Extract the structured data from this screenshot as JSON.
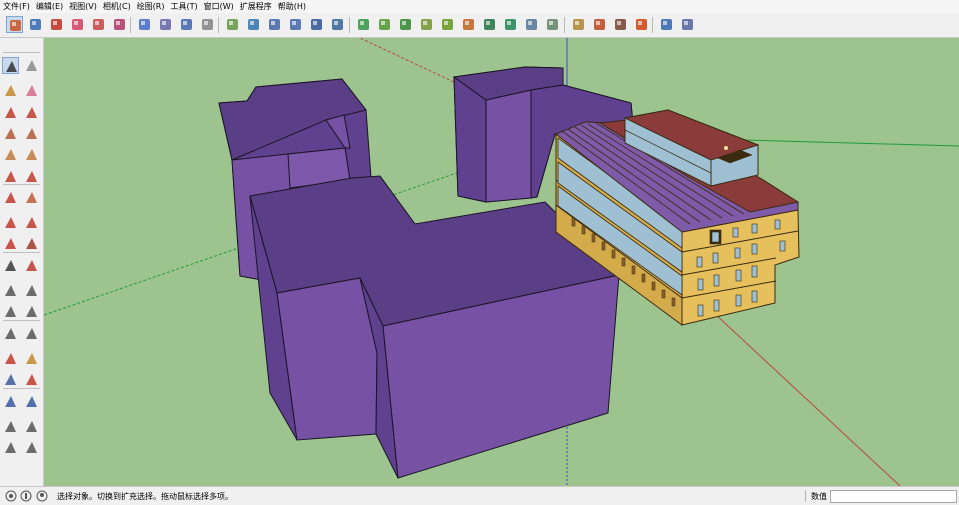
{
  "menu": [
    "文件(F)",
    "编辑(E)",
    "视图(V)",
    "相机(C)",
    "绘图(R)",
    "工具(T)",
    "窗口(W)",
    "扩展程序",
    "帮助(H)"
  ],
  "toolbar_icons": [
    "get-models-icon",
    "components-icon",
    "materials-icon",
    "styles-icon",
    "layers-icon",
    "scenes-icon",
    "iso-view-icon",
    "top-view-icon",
    "front-view-icon",
    "section-plane-icon",
    "new-surface-icon",
    "upload-icon",
    "save-geometry-icon",
    "save-component-icon",
    "idf-export-icon",
    "plugin-run-icon",
    "add-zone-icon",
    "add-space-icon",
    "add-shading-icon",
    "add-light-icon",
    "add-equipment-icon",
    "zone-loads-icon",
    "thermostat-icon",
    "hvac-icon",
    "render-mode-icon",
    "view-grid-icon",
    "search-icon",
    "filter-icon",
    "info-icon",
    "warning-icon",
    "box-icon",
    "help-icon"
  ],
  "left_tools": [
    "select-tool-icon",
    "make-component-icon",
    "paint-bucket-icon",
    "eraser-icon",
    "line-tool-icon",
    "freehand-tool-icon",
    "rectangle-tool-icon",
    "rotated-rectangle-icon",
    "circle-tool-icon",
    "polygon-tool-icon",
    "arc-tool-icon",
    "two-point-arc-icon",
    "three-point-arc-icon",
    "pie-tool-icon",
    "move-tool-icon",
    "push-pull-icon",
    "rotate-tool-icon",
    "follow-me-icon",
    "scale-tool-icon",
    "offset-tool-icon",
    "tape-measure-icon",
    "dimension-tool-icon",
    "protractor-icon",
    "text-tool-icon",
    "axes-tool-icon",
    "3d-text-icon",
    "orbit-tool-icon",
    "pan-tool-icon",
    "zoom-tool-icon",
    "zoom-window-icon",
    "zoom-extents-icon",
    "previous-view-icon",
    "position-camera-icon",
    "look-around-icon",
    "walk-tool-icon",
    "section-tool-icon"
  ],
  "status": {
    "text": "选择对象。切换到扩充选择。拖动鼠标选择多项。",
    "measure_label": "数值",
    "measure_value": ""
  },
  "colors": {
    "viewport_bg": "#9dc38f",
    "building_top": "#5b3f86",
    "building_face_light": "#7651a4",
    "building_face_dark": "#5f4190",
    "facade_wall": "#e6c05c",
    "roof_red": "#8b3c3a",
    "glazing": "#9ec0d2"
  }
}
